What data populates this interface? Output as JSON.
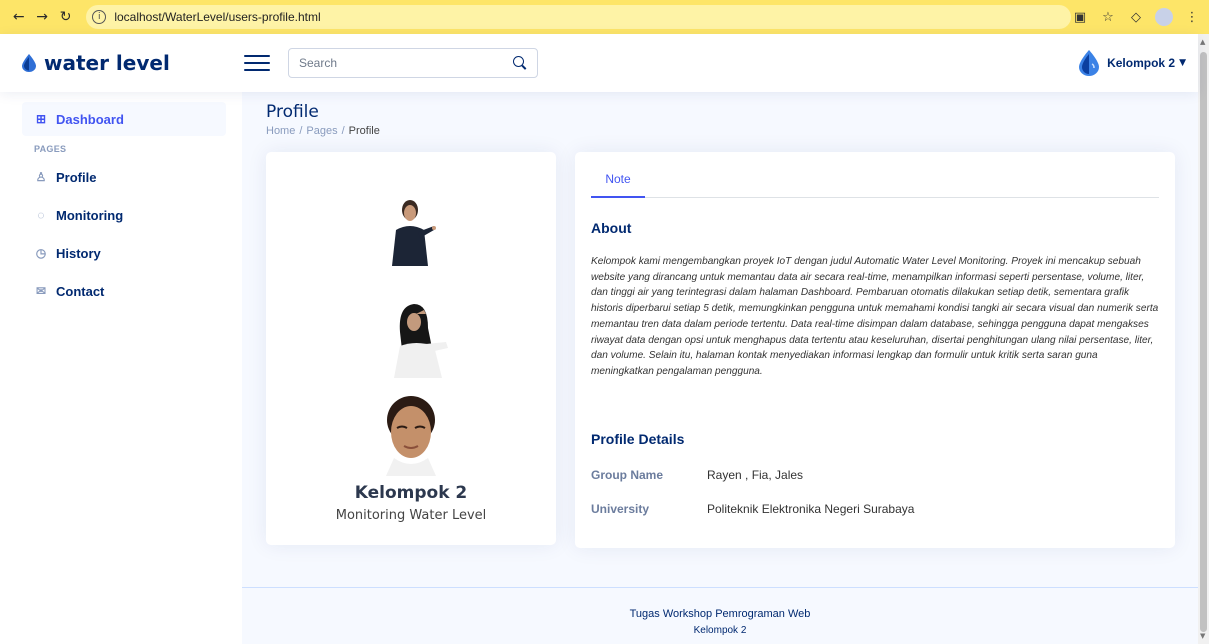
{
  "browser": {
    "url": "localhost/WaterLevel/users-profile.html",
    "colors": {
      "bar": "#fde568"
    }
  },
  "header": {
    "logo_text": "water level",
    "search_placeholder": "Search",
    "user_name": "Kelompok 2"
  },
  "sidebar": {
    "items": [
      {
        "label": "Dashboard",
        "icon": "grid-icon",
        "active": true
      },
      {
        "label": "Profile",
        "icon": "person-icon"
      },
      {
        "label": "Monitoring",
        "icon": "water-icon"
      },
      {
        "label": "History",
        "icon": "clock-icon"
      },
      {
        "label": "Contact",
        "icon": "envelope-icon"
      }
    ],
    "section_heading": "PAGES"
  },
  "page": {
    "title": "Profile",
    "breadcrumb": [
      "Home",
      "Pages",
      "Profile"
    ]
  },
  "profile_card": {
    "name": "Kelompok 2",
    "subtitle": "Monitoring Water Level"
  },
  "content_card": {
    "tab": "Note",
    "about_title": "About",
    "about_text": "Kelompok kami mengembangkan proyek IoT dengan judul Automatic Water Level Monitoring. Proyek ini mencakup sebuah website yang dirancang untuk memantau data air secara real-time, menampilkan informasi seperti persentase, volume, liter, dan tinggi air yang terintegrasi dalam halaman Dashboard. Pembaruan otomatis dilakukan setiap detik, sementara grafik historis diperbarui setiap 5 detik, memungkinkan pengguna untuk memahami kondisi tangki air secara visual dan numerik serta memantau tren data dalam periode tertentu. Data real-time disimpan dalam database, sehingga pengguna dapat mengakses riwayat data dengan opsi untuk menghapus data tertentu atau keseluruhan, disertai penghitungan ulang nilai persentase, liter, dan volume. Selain itu, halaman kontak menyediakan informasi lengkap dan formulir untuk kritik serta saran guna meningkatkan pengalaman pengguna.",
    "details_title": "Profile Details",
    "details": [
      {
        "label": "Group Name",
        "value": "Rayen , Fia, Jales"
      },
      {
        "label": "University",
        "value": "Politeknik Elektronika Negeri Surabaya"
      }
    ]
  },
  "footer": {
    "line1": "Tugas Workshop Pemrograman Web",
    "line2": "Kelompok 2"
  },
  "colors": {
    "primary": "#4154f1",
    "navy": "#012970",
    "background": "#f6f9ff"
  }
}
